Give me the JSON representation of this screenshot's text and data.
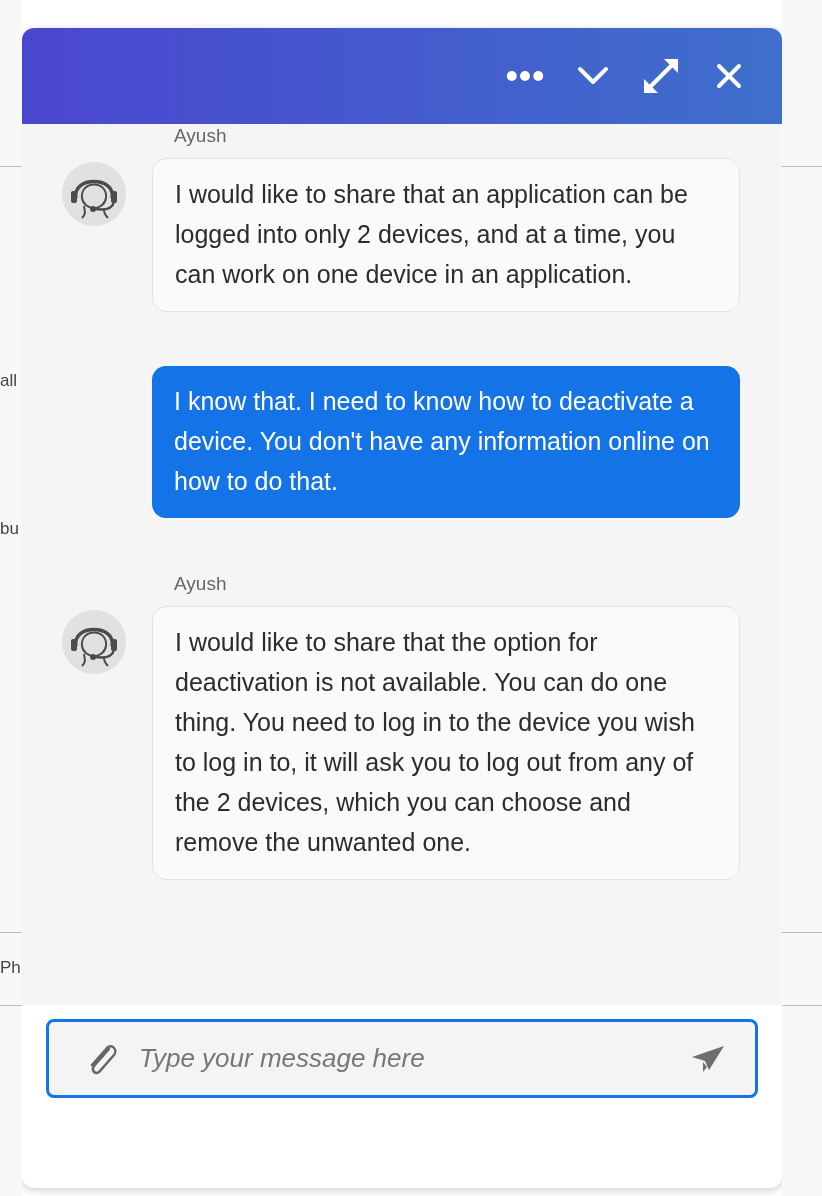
{
  "background_page": {
    "fragments": [
      "all",
      "bu",
      "Ph"
    ]
  },
  "chat": {
    "header": {
      "buttons": [
        {
          "kind": "more"
        },
        {
          "kind": "minimize"
        },
        {
          "kind": "expand"
        },
        {
          "kind": "close"
        }
      ]
    },
    "messages": [
      {
        "kind": "agent",
        "sender": "Ayush",
        "text": "I would like to share that an application can be logged into only 2 devices, and at a time, you can work on one device in an application."
      },
      {
        "kind": "user",
        "text": "I know that. I need to know how to deactivate a device. You don't have any information online on how to do that."
      },
      {
        "kind": "agent",
        "sender": "Ayush",
        "text": "I would like to share that the option for deactivation is not available. You can do one thing. You need to log in to the device you wish to log in to, it will ask you to log out from any of the 2 devices, which you can choose and remove the unwanted one."
      }
    ],
    "composer": {
      "placeholder": "Type your message here"
    }
  }
}
